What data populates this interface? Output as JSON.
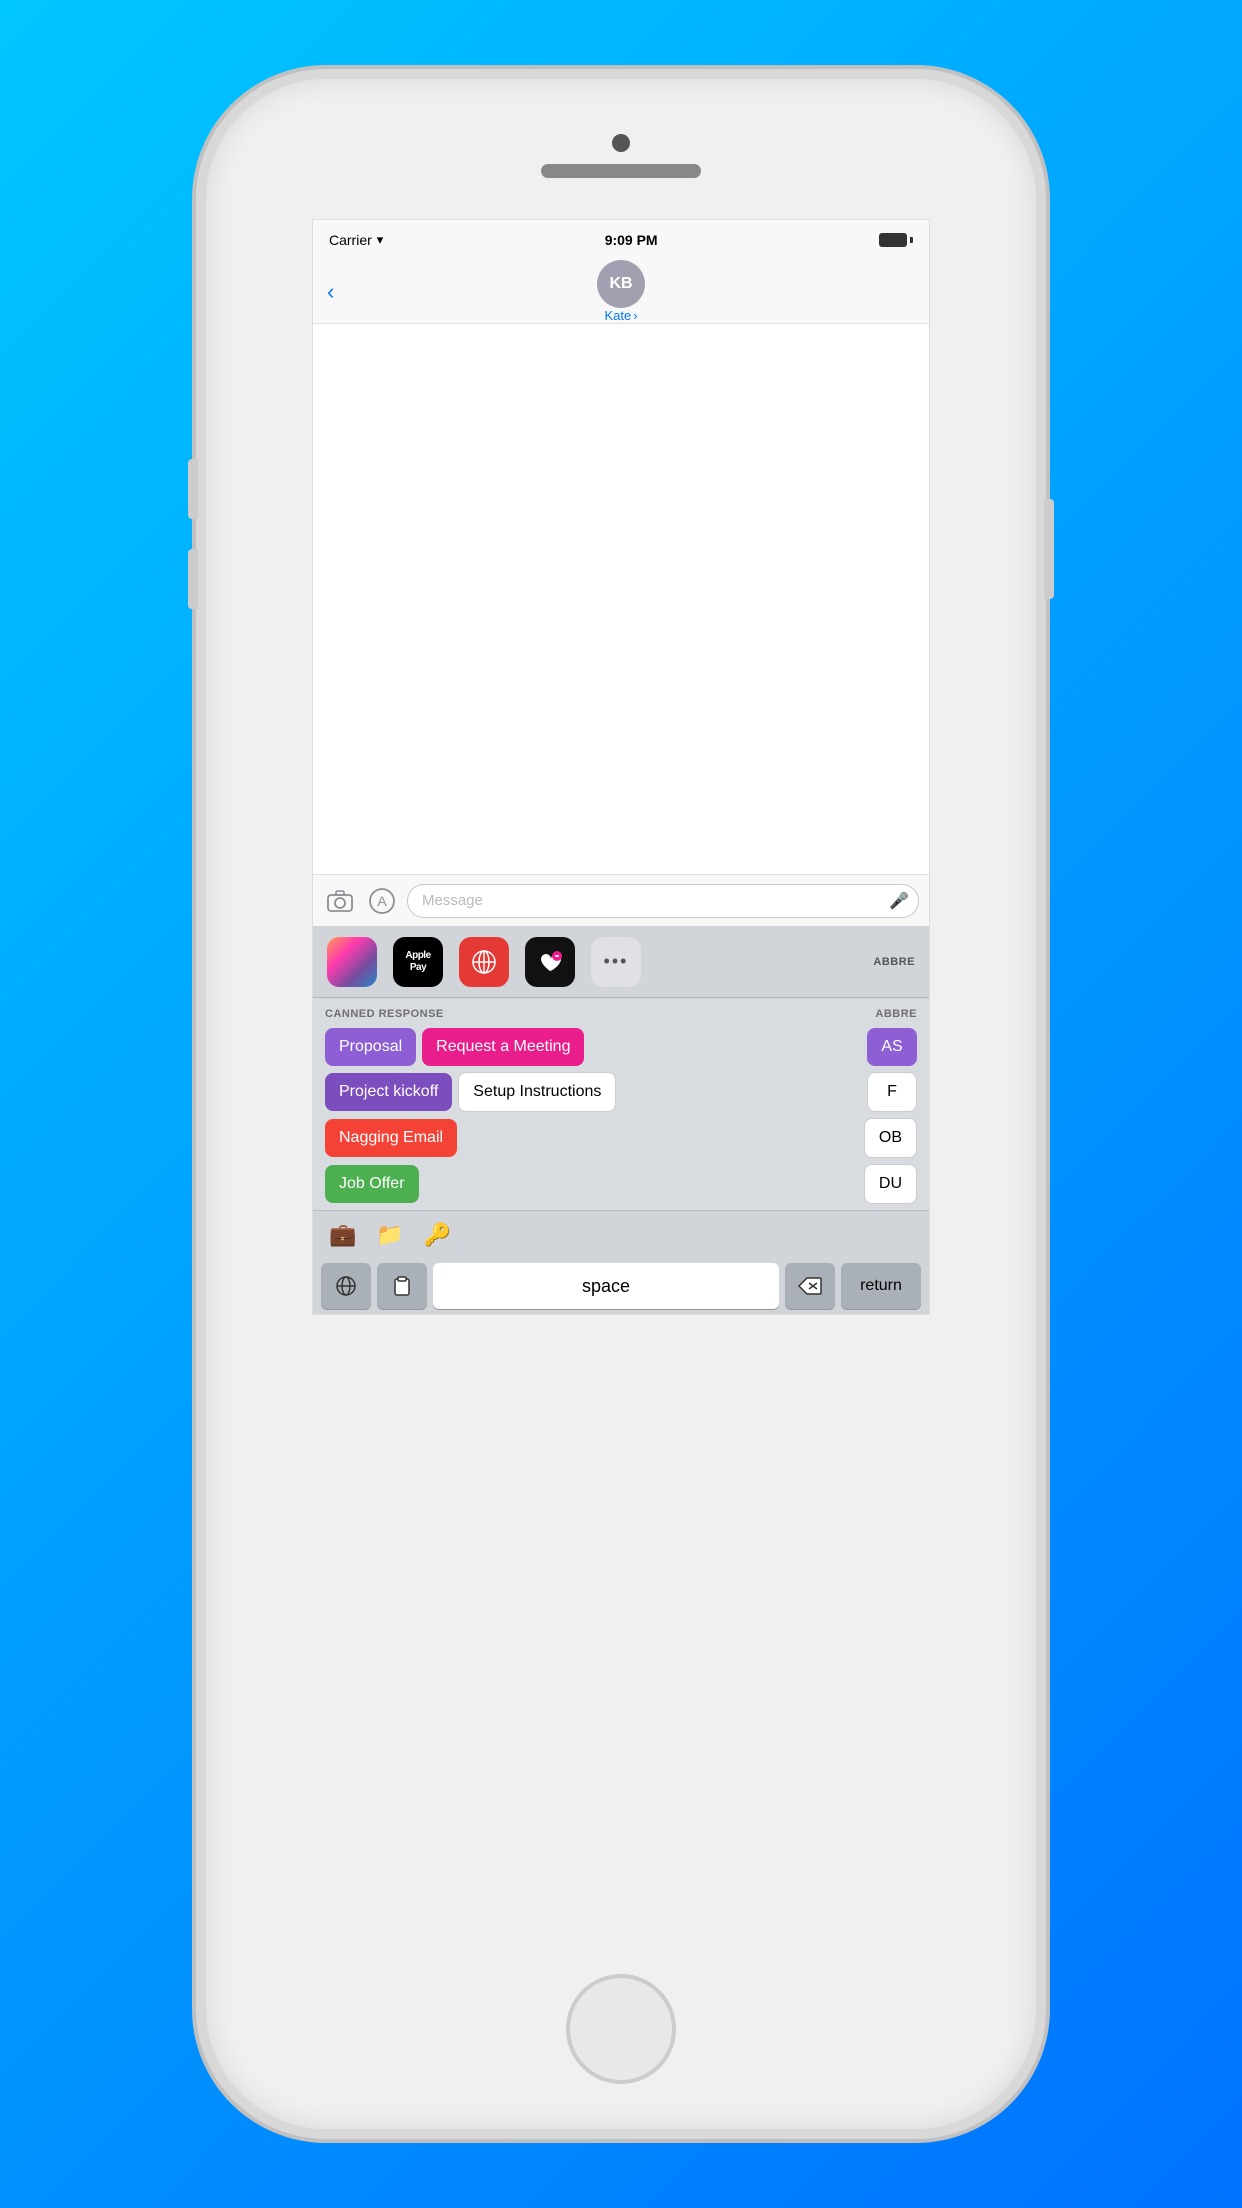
{
  "status_bar": {
    "carrier": "Carrier",
    "time": "9:09 PM"
  },
  "nav": {
    "back_label": "‹",
    "contact_initials": "KB",
    "contact_name": "Kate",
    "chevron": "›"
  },
  "input": {
    "placeholder": "Message",
    "mic_icon": "🎤"
  },
  "app_strip": {
    "apps": [
      {
        "id": "photos",
        "label": "🌈"
      },
      {
        "id": "apple-pay",
        "label": "Apple Pay"
      },
      {
        "id": "web",
        "label": "🌐"
      },
      {
        "id": "heart",
        "label": "🖤"
      },
      {
        "id": "more",
        "label": "•••"
      }
    ],
    "abbrev_label": "ABBRE"
  },
  "canned_response": {
    "section_label": "CANNED RESPONSE",
    "abbrev_label": "ABBRE",
    "buttons": [
      {
        "id": "proposal",
        "label": "Proposal",
        "style": "purple"
      },
      {
        "id": "request-meeting",
        "label": "Request a Meeting",
        "style": "pink"
      },
      {
        "id": "project-kickoff",
        "label": "Project kickoff",
        "style": "purple2"
      },
      {
        "id": "setup-instructions",
        "label": "Setup Instructions",
        "style": "white"
      },
      {
        "id": "nagging-email",
        "label": "Nagging Email",
        "style": "red"
      },
      {
        "id": "job-offer",
        "label": "Job Offer",
        "style": "green"
      }
    ],
    "abbrev_buttons": [
      {
        "id": "as",
        "label": "AS",
        "style": "purple"
      },
      {
        "id": "f",
        "label": "F",
        "style": "white"
      },
      {
        "id": "ob",
        "label": "OB",
        "style": "white"
      },
      {
        "id": "du",
        "label": "DU",
        "style": "white"
      }
    ]
  },
  "emoji_row": {
    "icons": [
      "💼",
      "📁",
      "🔑"
    ]
  },
  "keyboard": {
    "globe_icon": "🌐",
    "clipboard_icon": "⬜",
    "space_label": "space",
    "delete_icon": "⌫",
    "return_label": "return"
  }
}
